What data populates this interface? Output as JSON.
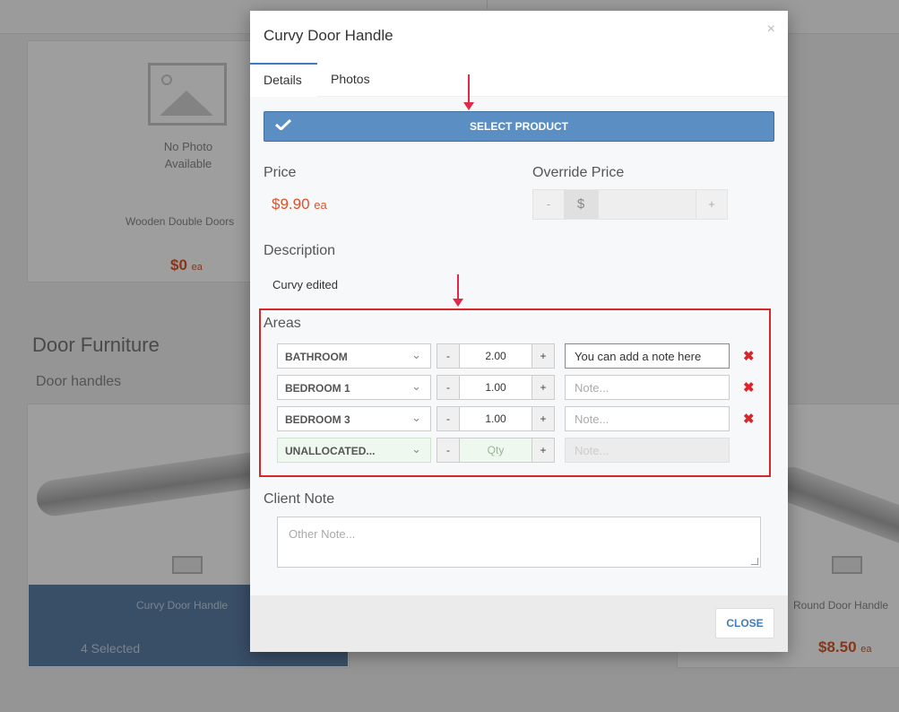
{
  "background": {
    "no_photo": "No Photo Available",
    "product1_name": "Wooden Double Doors",
    "product1_price": "$0",
    "product1_unit": "ea",
    "category": "Door Furniture",
    "subcategory": "Door handles",
    "card_left_name": "Curvy Door Handle",
    "card_left_selected": "4 Selected",
    "card_right_name": "Round Door Handle",
    "card_right_price": "$8.50",
    "card_right_unit": "ea"
  },
  "modal": {
    "title": "Curvy Door Handle",
    "tabs": [
      {
        "label": "Details"
      },
      {
        "label": "Photos"
      }
    ],
    "select_button": "SELECT PRODUCT",
    "price_label": "Price",
    "price_value": "$9.90",
    "price_unit": "ea",
    "override_label": "Override Price",
    "override_minus": "-",
    "override_currency": "$",
    "override_plus": "+",
    "description_label": "Description",
    "description_text": "Curvy edited",
    "areas_label": "Areas",
    "areas": [
      {
        "name": "BATHROOM",
        "minus": "-",
        "qty": "2.00",
        "plus": "+",
        "note": "You can add a note here"
      },
      {
        "name": "BEDROOM 1",
        "minus": "-",
        "qty": "1.00",
        "plus": "+",
        "note_placeholder": "Note..."
      },
      {
        "name": "BEDROOM 3",
        "minus": "-",
        "qty": "1.00",
        "plus": "+",
        "note_placeholder": "Note..."
      },
      {
        "name": "UNALLOCATED...",
        "minus": "-",
        "qty_placeholder": "Qty",
        "plus": "+",
        "note_placeholder": "Note..."
      }
    ],
    "client_note_label": "Client Note",
    "client_note_placeholder": "Other Note...",
    "close_button": "CLOSE",
    "close_x": "×"
  },
  "colors": {
    "accent": "#5b8ec3",
    "price": "#e0502a",
    "highlight_border": "#d9262b",
    "arrow": "#e0284a"
  }
}
